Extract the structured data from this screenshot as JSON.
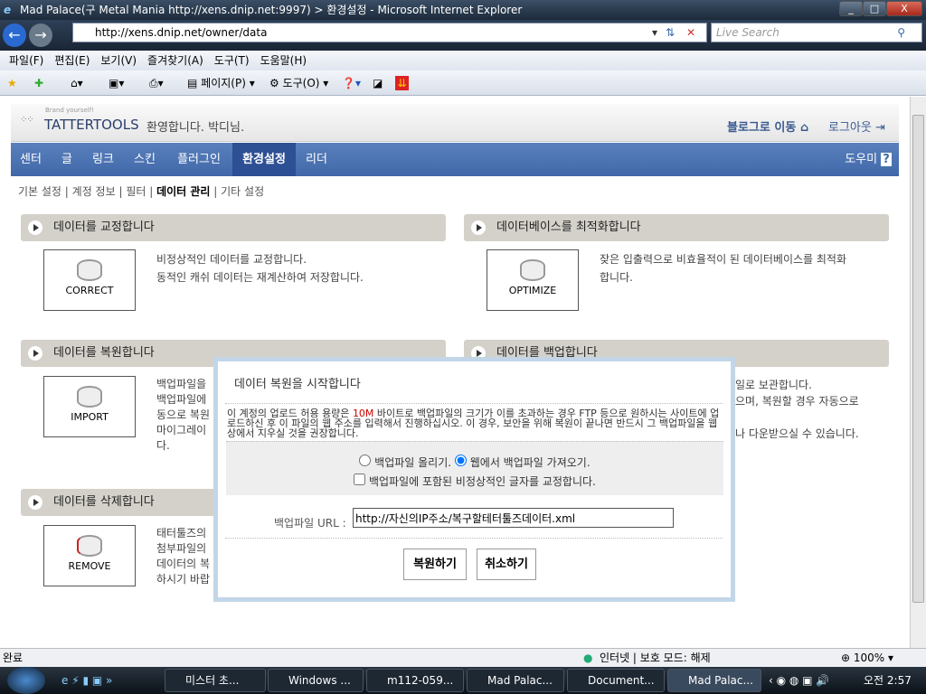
{
  "browser": {
    "title": "Mad Palace(구 Metal Mania http://xens.dnip.net:9997) > 환경설정 - Microsoft Internet Explorer",
    "url": "http://xens.dnip.net/owner/data",
    "search_placeholder": "Live Search",
    "menu": [
      "파일(F)",
      "편집(E)",
      "보기(V)",
      "즐겨찾기(A)",
      "도구(T)",
      "도움말(H)"
    ],
    "toolbar": {
      "page": "페이지(P)",
      "tools": "도구(O)"
    }
  },
  "header": {
    "tagline": "Brand yourself!",
    "logo": "TATTERTOOLS",
    "welcome": "환영합니다. 박디님.",
    "go_blog": "블로그로 이동",
    "logout": "로그아웃"
  },
  "nav": {
    "tabs": [
      "센터",
      "글",
      "링크",
      "스킨",
      "플러그인",
      "환경설정",
      "리더"
    ],
    "help": "도우미"
  },
  "subnav": [
    "기본 설정",
    "계정 정보",
    "필터",
    "데이터 관리",
    "기타 설정"
  ],
  "sections": {
    "correct": {
      "title": "데이터를 교정합니다",
      "icon_label": "CORRECT",
      "desc": [
        "비정상적인 데이터를 교정합니다.",
        "동적인 캐쉬 데이터는 재계산하여 저장합니다."
      ]
    },
    "optimize": {
      "title": "데이터베이스를 최적화합니다",
      "icon_label": "OPTIMIZE",
      "desc": [
        "잦은 입출력으로 비효율적이 된 데이터베이스를 최적화",
        "합니다."
      ]
    },
    "import": {
      "title": "데이터를 복원합니다",
      "icon_label": "IMPORT",
      "desc": [
        "백업파일을",
        "백업파일에",
        "동으로 복원",
        "마이그레이",
        "다."
      ]
    },
    "backup": {
      "title": "데이터를 백업합니다",
      "desc": [
        "일로 보관합니다.",
        "으며, 복원할 경우 자동으로",
        "",
        "나 다운받으실 수 있습니다."
      ]
    },
    "remove": {
      "title": "데이터를 삭제합니다",
      "icon_label": "REMOVE",
      "desc": [
        "태터툴즈의",
        "첨부파일의",
        "데이터의 복",
        "하시기 바랍"
      ]
    }
  },
  "modal": {
    "title": "데이터 복원을 시작합니다",
    "notice_pre": "이 계정의 업로드 허용 용량은 ",
    "notice_limit": "10M",
    "notice_post": " 바이트로 백업파일의 크기가 이를 초과하는 경우 FTP 등으로 원하시는 사이트에 업로드하신 후 이 파일의 웹 주소를 입력해서 진행하십시오. 이 경우, 보안을 위해 복원이 끝나면 반드시 그 백업파일을 웹 상에서 지우실 것을 권장합니다.",
    "radio_upload": "백업파일 올리기.",
    "radio_web": "웹에서 백업파일 가져오기.",
    "selected": "web",
    "checkbox_fix": "백업파일에 포함된 비정상적인 글자를 교정합니다.",
    "checkbox_checked": false,
    "url_label": "백업파일 URL :",
    "url_value": "http://자신의IP주소/복구할테터툴즈데이터.xml",
    "restore": "복원하기",
    "cancel": "취소하기",
    "accent": "#cc0000"
  },
  "status": {
    "text": "완료",
    "zone": "인터넷 | 보호 모드: 해제",
    "zoom": "100%"
  },
  "taskbar": {
    "items": [
      "미스터 초...",
      "Windows ...",
      "m112-059...",
      "Mad Palac...",
      "Document...",
      "Mad Palac..."
    ],
    "clock": "오전 2:57"
  }
}
